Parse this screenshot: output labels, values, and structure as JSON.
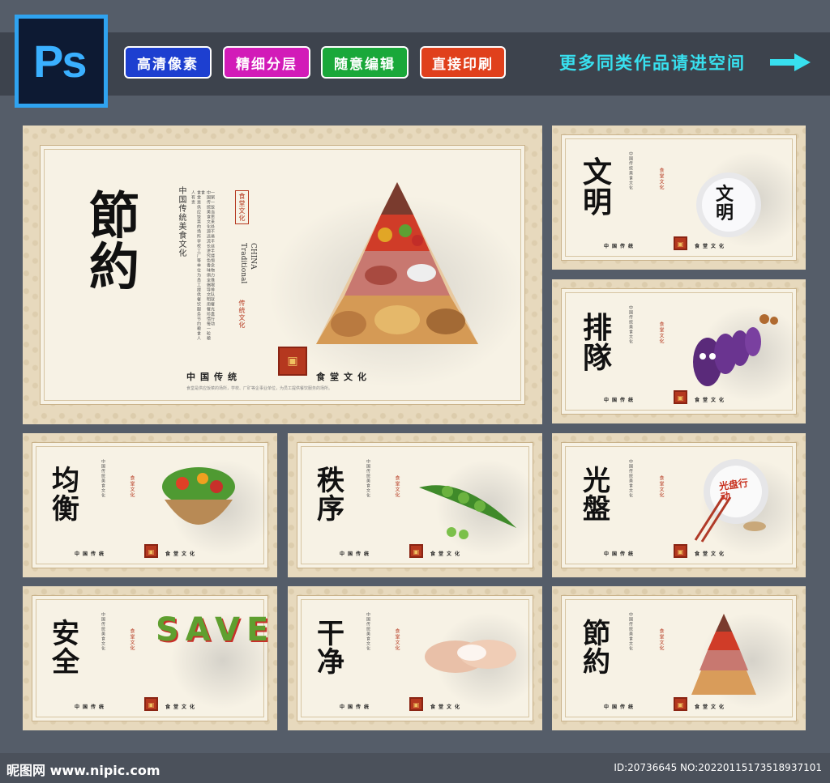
{
  "badges": [
    {
      "label": "高清像素",
      "color": "#1d3fd0"
    },
    {
      "label": "精细分层",
      "color": "#d21bb8"
    },
    {
      "label": "随意编辑",
      "color": "#1aa83a"
    },
    {
      "label": "直接印刷",
      "color": "#e0401c"
    }
  ],
  "ps_logo": "Ps",
  "more_text": "更多同类作品请进空间",
  "big_panel": {
    "title": "節約",
    "vertical_heading": "中国传统美食文化",
    "tag_top": "食堂文化",
    "tag_bottom": "传统文化",
    "english_1": "Traditional",
    "english_2": "CHINA",
    "footer_left": "中国传统",
    "footer_right": "食堂文化"
  },
  "panels": [
    {
      "title": "文明",
      "plate_text": "文明",
      "footer_left": "中国传统",
      "footer_right": "食堂文化"
    },
    {
      "title": "排隊",
      "footer_left": "中国传统",
      "footer_right": "食堂文化"
    },
    {
      "title": "均衡",
      "footer_left": "中国传统",
      "footer_right": "食堂文化"
    },
    {
      "title": "秩序",
      "footer_left": "中国传统",
      "footer_right": "食堂文化"
    },
    {
      "title": "光盤",
      "plate_text": "光盘行动",
      "footer_left": "中国传统",
      "footer_right": "食堂文化"
    },
    {
      "title": "安全",
      "save_letters": "SAVE",
      "footer_left": "中国传统",
      "footer_right": "食堂文化"
    },
    {
      "title": "干净",
      "footer_left": "中国传统",
      "footer_right": "食堂文化"
    },
    {
      "title": "節約",
      "footer_left": "中国传统",
      "footer_right": "食堂文化"
    }
  ],
  "watermark": "昵图网 www.nipic.com",
  "id_text": "ID:20736645 NO:20220115173518937101"
}
